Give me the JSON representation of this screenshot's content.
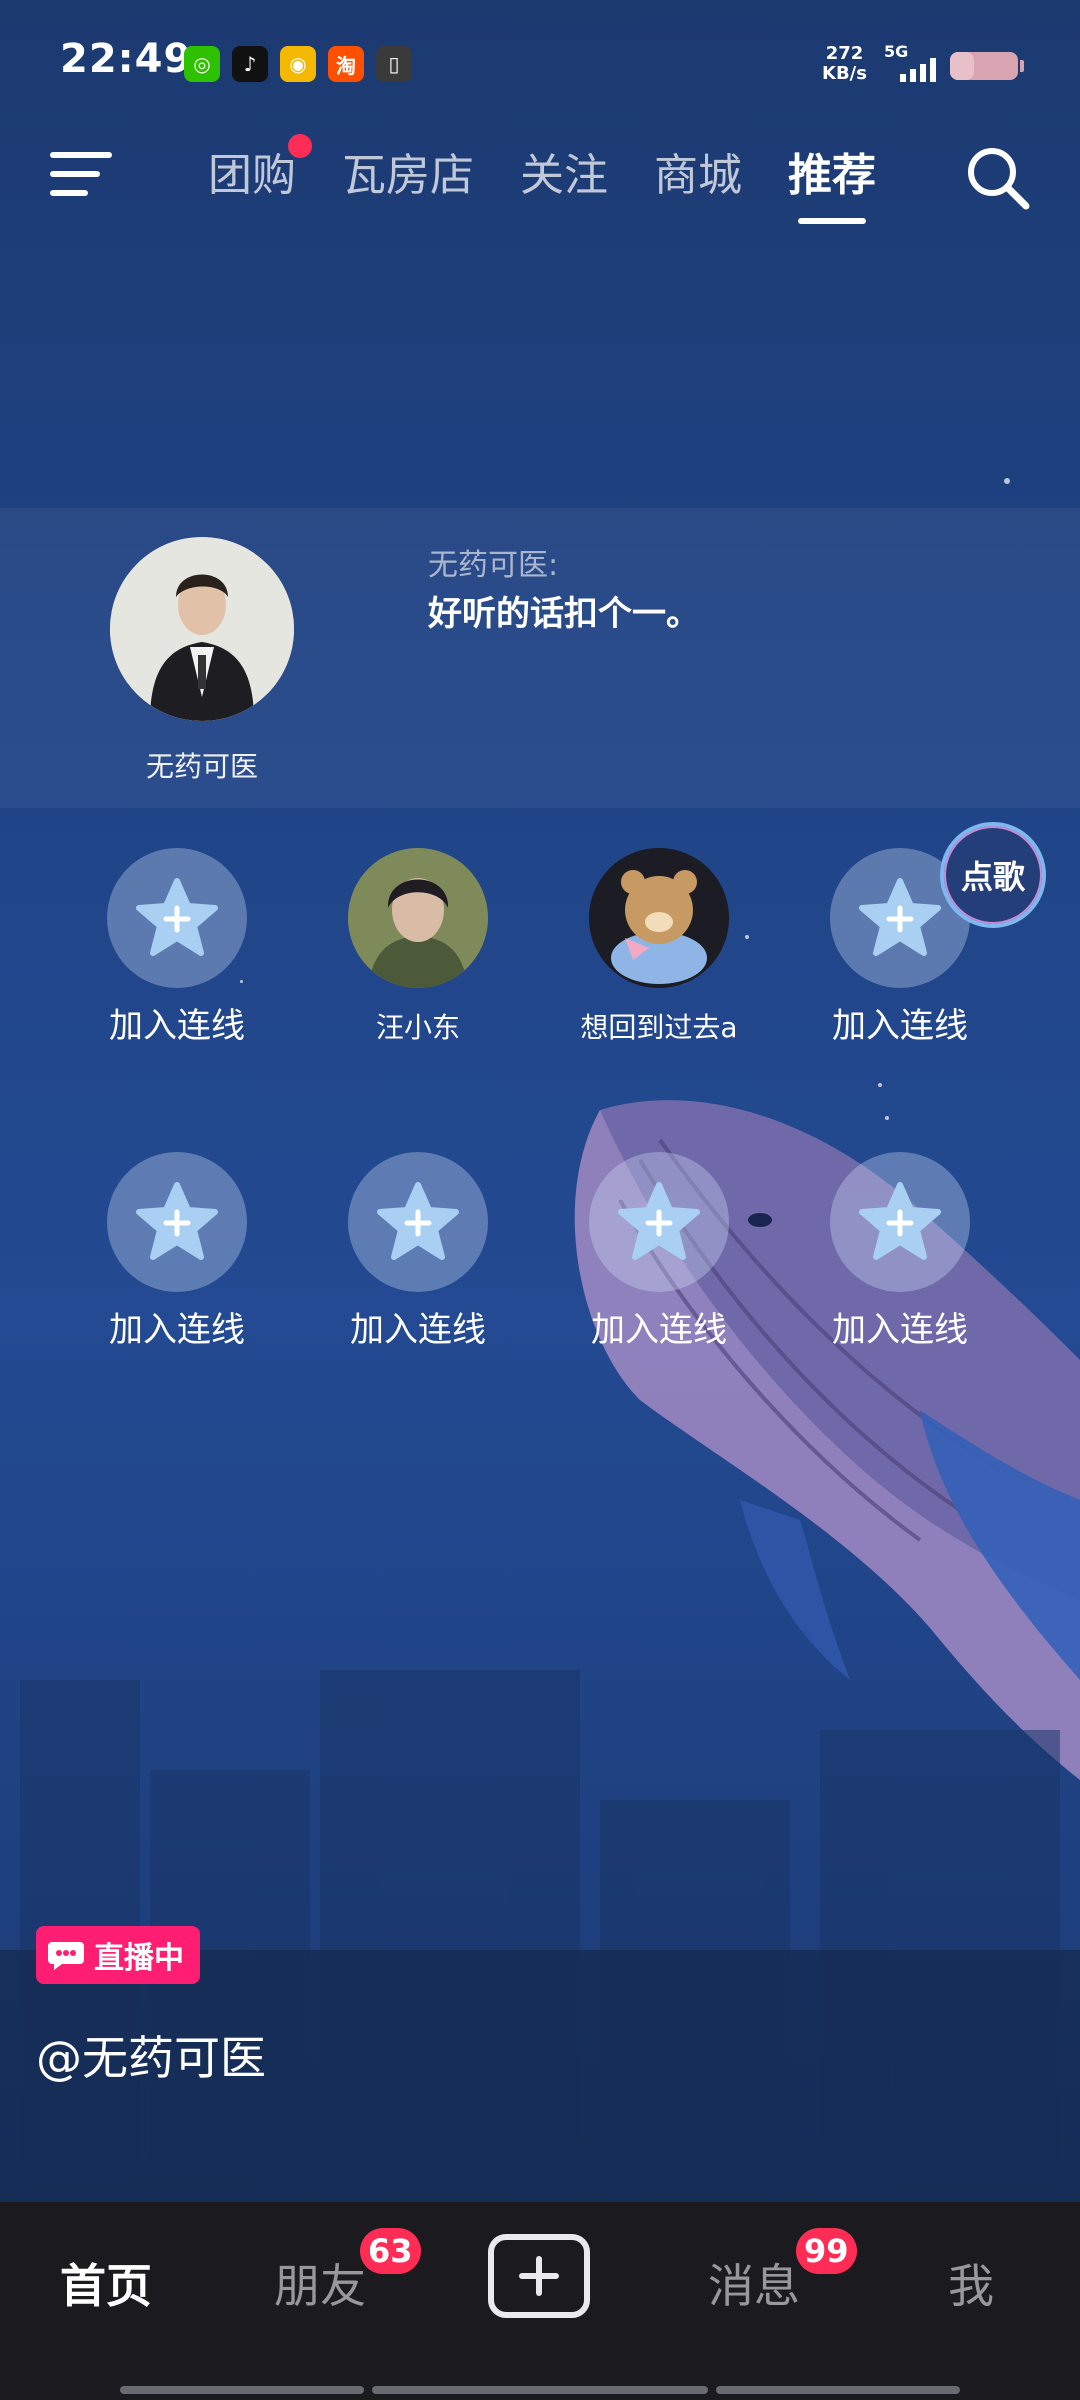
{
  "status_bar": {
    "time": "22:49",
    "app_icons": [
      {
        "name": "wechat-icon",
        "glyph": "◎",
        "color": "#2dc100"
      },
      {
        "name": "tiktok-icon",
        "glyph": "♪",
        "color": "#111111"
      },
      {
        "name": "weibo-icon",
        "glyph": "◉",
        "color": "#f5b800"
      },
      {
        "name": "taobao-icon",
        "glyph": "淘",
        "color": "#ff5000"
      },
      {
        "name": "app-icon",
        "glyph": "▯",
        "color": "#3a3a3a"
      }
    ],
    "net_speed_value": "272",
    "net_speed_unit": "KB/s",
    "net_type": "5G",
    "battery_level": 0.35
  },
  "nav": {
    "tabs": [
      {
        "label": "团购",
        "active": false,
        "dot": true
      },
      {
        "label": "瓦房店",
        "active": false,
        "dot": false
      },
      {
        "label": "关注",
        "active": false,
        "dot": false
      },
      {
        "label": "商城",
        "active": false,
        "dot": false
      },
      {
        "label": "推荐",
        "active": true,
        "dot": false
      }
    ]
  },
  "host": {
    "name": "无药可医",
    "chat_user": "无药可医:",
    "chat_text": "好听的话扣个一。"
  },
  "seats": {
    "row1": [
      {
        "label": "加入连线",
        "type": "empty"
      },
      {
        "label": "汪小东",
        "type": "user"
      },
      {
        "label": "想回到过去a",
        "type": "user"
      },
      {
        "label": "加入连线",
        "type": "empty"
      }
    ],
    "row2": [
      {
        "label": "加入连线",
        "type": "empty"
      },
      {
        "label": "加入连线",
        "type": "empty"
      },
      {
        "label": "加入连线",
        "type": "empty"
      },
      {
        "label": "加入连线",
        "type": "empty"
      }
    ],
    "song_badge": "点歌"
  },
  "live": {
    "badge": "直播中",
    "handle": "@无药可医"
  },
  "bottom_nav": {
    "home": "首页",
    "friends": "朋友",
    "friends_badge": "63",
    "messages": "消息",
    "messages_badge": "99",
    "me": "我"
  },
  "colors": {
    "accent": "#ff2d55",
    "live_badge": "#ff1e72",
    "background": "#234a92"
  }
}
